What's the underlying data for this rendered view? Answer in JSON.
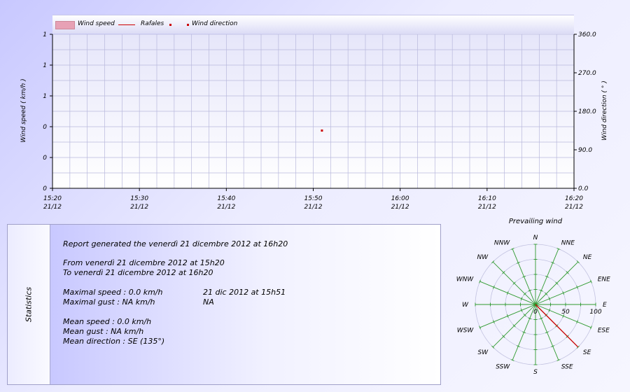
{
  "chart_data": [
    {
      "type": "area",
      "xlabel": "",
      "ylabel": "Wind speed  ( km/h )",
      "y2label": "Wind direction  ( ° )",
      "x_ticks": [
        {
          "time": "15:20",
          "date": "21/12"
        },
        {
          "time": "15:30",
          "date": "21/12"
        },
        {
          "time": "15:40",
          "date": "21/12"
        },
        {
          "time": "15:50",
          "date": "21/12"
        },
        {
          "time": "16:00",
          "date": "21/12"
        },
        {
          "time": "16:10",
          "date": "21/12"
        },
        {
          "time": "16:20",
          "date": "21/12"
        }
      ],
      "y_ticks": [
        "0",
        "0",
        "0",
        "1",
        "1",
        "1"
      ],
      "y2_ticks": [
        "0.0",
        "90.0",
        "180.0",
        "270.0",
        "360.0"
      ],
      "ylim": [
        0,
        1
      ],
      "y2lim": [
        0,
        360
      ],
      "xlim": [
        "15:20",
        "16:20"
      ],
      "grid": true,
      "legend_position": "top",
      "series": [
        {
          "name": "Wind speed",
          "values": []
        },
        {
          "name": "Rafales",
          "values": []
        },
        {
          "name": "Wind direction",
          "points": [
            {
              "x": "15:51",
              "y": 135
            }
          ]
        }
      ]
    },
    {
      "type": "polar",
      "title": "Prevailing wind",
      "directions": [
        "N",
        "NNE",
        "NE",
        "ENE",
        "E",
        "ESE",
        "SE",
        "SSE",
        "S",
        "SSW",
        "SW",
        "WSW",
        "W",
        "WNW",
        "NW",
        "NNW"
      ],
      "radial_ticks": [
        "0",
        "50",
        "100"
      ],
      "rlim": [
        0,
        100
      ],
      "series": [
        {
          "direction": "SE",
          "value": 100
        }
      ]
    }
  ],
  "colors": {
    "grid": "#b8b8dc",
    "speed_fill": "#e7a1b5",
    "gust_line": "#cc0000",
    "direction_marker": "#cc0000",
    "rose_spokes": "#2e9a2e",
    "rose_value": "#cc0000"
  },
  "statistics": {
    "title": "Statistics",
    "report": "Report generated the venerdì 21 dicembre 2012 at 16h20",
    "from": "From venerdì 21 dicembre 2012 at 15h20",
    "to": "To venerdì 21 dicembre 2012 at 16h20",
    "max_speed": "Maximal speed : 0.0 km/h",
    "max_speed_when": "21 dic 2012 at 15h51",
    "max_gust": "Maximal gust : NA km/h",
    "max_gust_when": "NA",
    "mean_speed": "Mean speed : 0.0 km/h",
    "mean_gust": "Mean gust : NA km/h",
    "mean_direction": "Mean direction : SE (135°)"
  }
}
